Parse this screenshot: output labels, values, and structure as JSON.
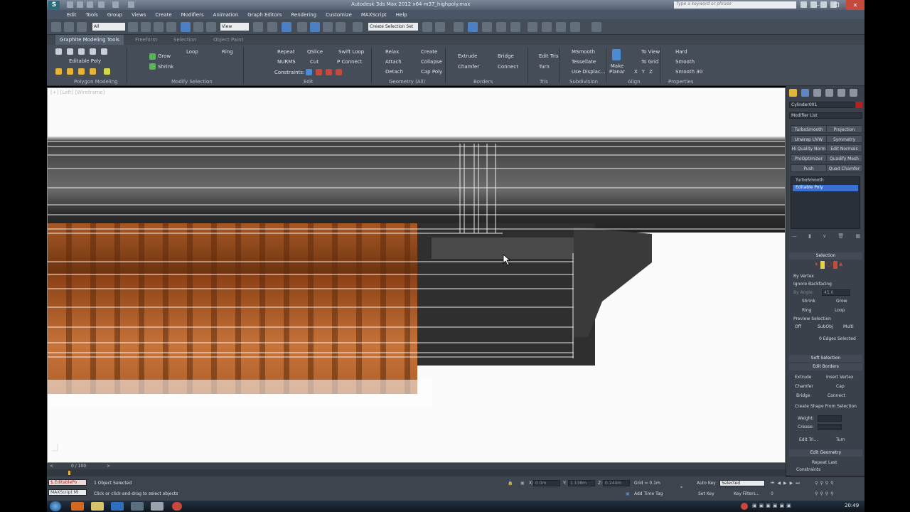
{
  "title": "Autodesk 3ds Max  2012 x64    m37_highpoly.max",
  "search": {
    "placeholder": "Type a keyword or phrase"
  },
  "menu": [
    "Edit",
    "Tools",
    "Group",
    "Views",
    "Create",
    "Modifiers",
    "Animation",
    "Graph Editors",
    "Rendering",
    "Customize",
    "MAXScript",
    "Help"
  ],
  "toolbar": {
    "filter": "All",
    "refcoord": "View",
    "selset": "Create Selection Set"
  },
  "ribbon": {
    "tabs": [
      "Graphite Modeling Tools",
      "Freeform",
      "Selection",
      "Object Paint"
    ],
    "object": "Editable Poly",
    "groups": [
      "Polygon Modeling",
      "Modify Selection",
      "Edit",
      "Geometry (All)",
      "Borders",
      "Tris",
      "Subdivision",
      "Align",
      "Properties"
    ],
    "modsel": [
      "Grow",
      "Shrink",
      "Loop",
      "Ring"
    ],
    "edit": [
      "Repeat",
      "QSlice",
      "Swift Loop",
      "NURMS",
      "Cut",
      "P Connect",
      "Constraints:"
    ],
    "geometry": [
      "Relax",
      "Create",
      "Attach",
      "Collapse",
      "Detach",
      "Cap Poly"
    ],
    "borders": [
      "Extrude",
      "Bridge",
      "Chamfer",
      "Connect"
    ],
    "tris": [
      "Edit Tris",
      "Turn"
    ],
    "subdivision": [
      "MSmooth",
      "Tessellate",
      "Use Displac..."
    ],
    "align": [
      "Make Planar",
      "To View",
      "To Grid"
    ],
    "properties": [
      "Hard",
      "Smooth",
      "Smooth 30"
    ]
  },
  "viewport": {
    "label": "[+] [Left] [Wireframe]"
  },
  "command_panel": {
    "object_name": "Cylinder001",
    "modifier_list": "Modifier List",
    "mod_buttons": [
      "TurboSmooth",
      "Projection",
      "Unwrap UVW",
      "Symmetry",
      "Hi Quality Norm",
      "Edit Normals",
      "ProOptimizer",
      "Quadify Mesh",
      "Push",
      "Quad Chamfer"
    ],
    "stack": [
      "TurboSmooth",
      "Editable Poly"
    ],
    "selection": {
      "title": "Selection",
      "by_vertex": "By Vertex",
      "ignore_backfacing": "Ignore Backfacing",
      "by_angle": "By Angle:",
      "angle": "45.0",
      "shrink": "Shrink",
      "grow": "Grow",
      "ring": "Ring",
      "loop": "Loop",
      "preview": "Preview Selection",
      "off": "Off",
      "subobj": "SubObj",
      "multi": "Multi",
      "status": "0 Edges Selected"
    },
    "soft_selection": "Soft Selection",
    "edit_borders": {
      "title": "Edit Borders",
      "extrude": "Extrude",
      "insert_vertex": "Insert Vertex",
      "chamfer": "Chamfer",
      "cap": "Cap",
      "bridge": "Bridge",
      "connect": "Connect",
      "create_shape": "Create Shape From Selection",
      "weight": "Weight:",
      "crease": "Crease:",
      "edit_tri": "Edit Tri...",
      "turn": "Turn"
    },
    "edit_geometry": {
      "title": "Edit Geometry",
      "repeat_last": "Repeat Last",
      "constraints": "Constraints"
    }
  },
  "timeline": {
    "frame": "0 / 100"
  },
  "status": {
    "script1": "$.EditablePo",
    "script2": "MAXScript Mi",
    "objects": "1 Object Selected",
    "prompt": "Click or click-and-drag to select objects",
    "x_label": "X:",
    "x": "0.0m",
    "y_label": "Y:",
    "y": "1.138m",
    "z_label": "Z:",
    "z": "0.244m",
    "grid": "Grid = 0.1m",
    "auto_key": "Auto Key",
    "set_key": "Set Key",
    "key_mode": "Selected",
    "key_filters": "Key Filters...",
    "add_time_tag": "Add Time Tag"
  },
  "taskbar": {
    "time": "20:49"
  }
}
